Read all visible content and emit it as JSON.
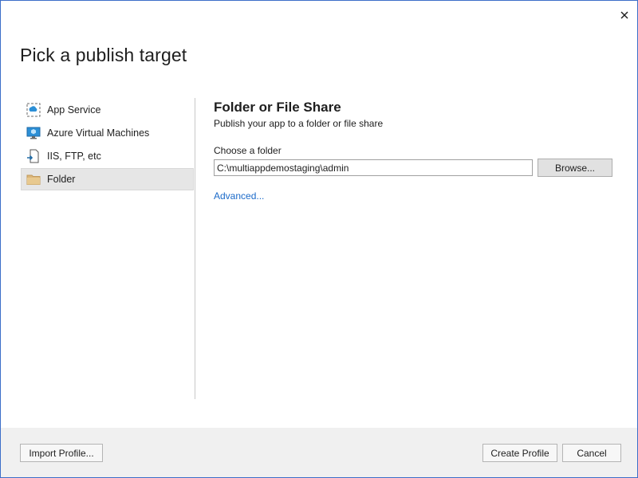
{
  "dialog": {
    "title": "Pick a publish target",
    "close_label": "×"
  },
  "sidebar": {
    "items": [
      {
        "label": "App Service",
        "icon": "app-service-icon",
        "selected": false
      },
      {
        "label": "Azure Virtual Machines",
        "icon": "virtual-machine-icon",
        "selected": false
      },
      {
        "label": "IIS, FTP, etc",
        "icon": "iis-ftp-icon",
        "selected": false
      },
      {
        "label": "Folder",
        "icon": "folder-icon",
        "selected": true
      }
    ]
  },
  "main": {
    "title": "Folder or File Share",
    "subtitle": "Publish your app to a folder or file share",
    "folder_label": "Choose a folder",
    "folder_value": "C:\\multiappdemostaging\\admin",
    "browse_label": "Browse...",
    "advanced_label": "Advanced..."
  },
  "footer": {
    "import_label": "Import Profile...",
    "create_label": "Create Profile",
    "cancel_label": "Cancel"
  },
  "colors": {
    "accent_link": "#1b6ac9",
    "selected_bg": "#e6e6e6",
    "footer_bg": "#f0f0f0",
    "window_border": "#3c6ec8"
  }
}
